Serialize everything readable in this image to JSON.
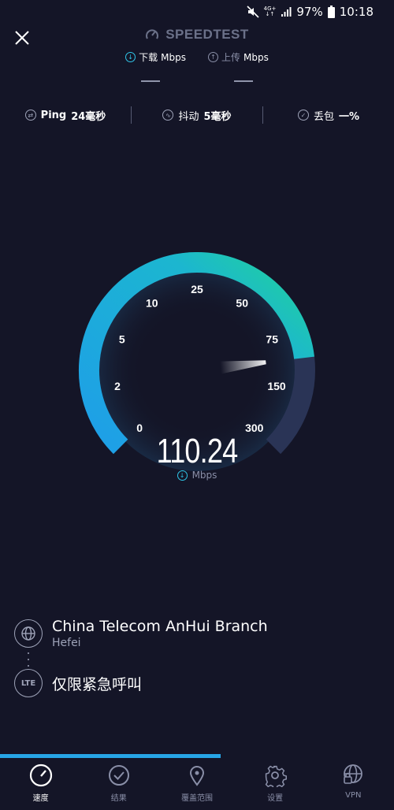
{
  "status_bar": {
    "network_top": "4G+",
    "network_bottom": "↓↑",
    "battery": "97%",
    "time": "10:18"
  },
  "header": {
    "brand": "SPEEDTEST",
    "download_label": "下载",
    "download_unit": "Mbps",
    "upload_label": "上传",
    "upload_unit": "Mbps"
  },
  "metrics": {
    "ping_label": "Ping",
    "ping_value": "24毫秒",
    "jitter_label": "抖动",
    "jitter_value": "5毫秒",
    "loss_label": "丢包",
    "loss_value": "一%"
  },
  "gauge": {
    "ticks": [
      "0",
      "2",
      "5",
      "10",
      "25",
      "50",
      "75",
      "150",
      "300"
    ],
    "reading": "110.24",
    "unit": "Mbps",
    "value_mbps": 110.24,
    "colors": {
      "start": "#1e9ee8",
      "end": "#20d39a",
      "track": "#2a3456"
    }
  },
  "server": {
    "name": "China Telecom AnHui Branch",
    "city": "Hefei"
  },
  "provider": {
    "badge": "LTE",
    "name": "仅限紧急呼叫"
  },
  "progress": {
    "fraction": 0.56
  },
  "tabs": [
    {
      "label": "速度",
      "icon": "speedometer-icon",
      "active": true
    },
    {
      "label": "结果",
      "icon": "check-circle-icon",
      "active": false
    },
    {
      "label": "覆盖范围",
      "icon": "map-pin-icon",
      "active": false
    },
    {
      "label": "设置",
      "icon": "gear-icon",
      "active": false
    },
    {
      "label": "VPN",
      "icon": "vpn-globe-icon",
      "active": false
    }
  ]
}
